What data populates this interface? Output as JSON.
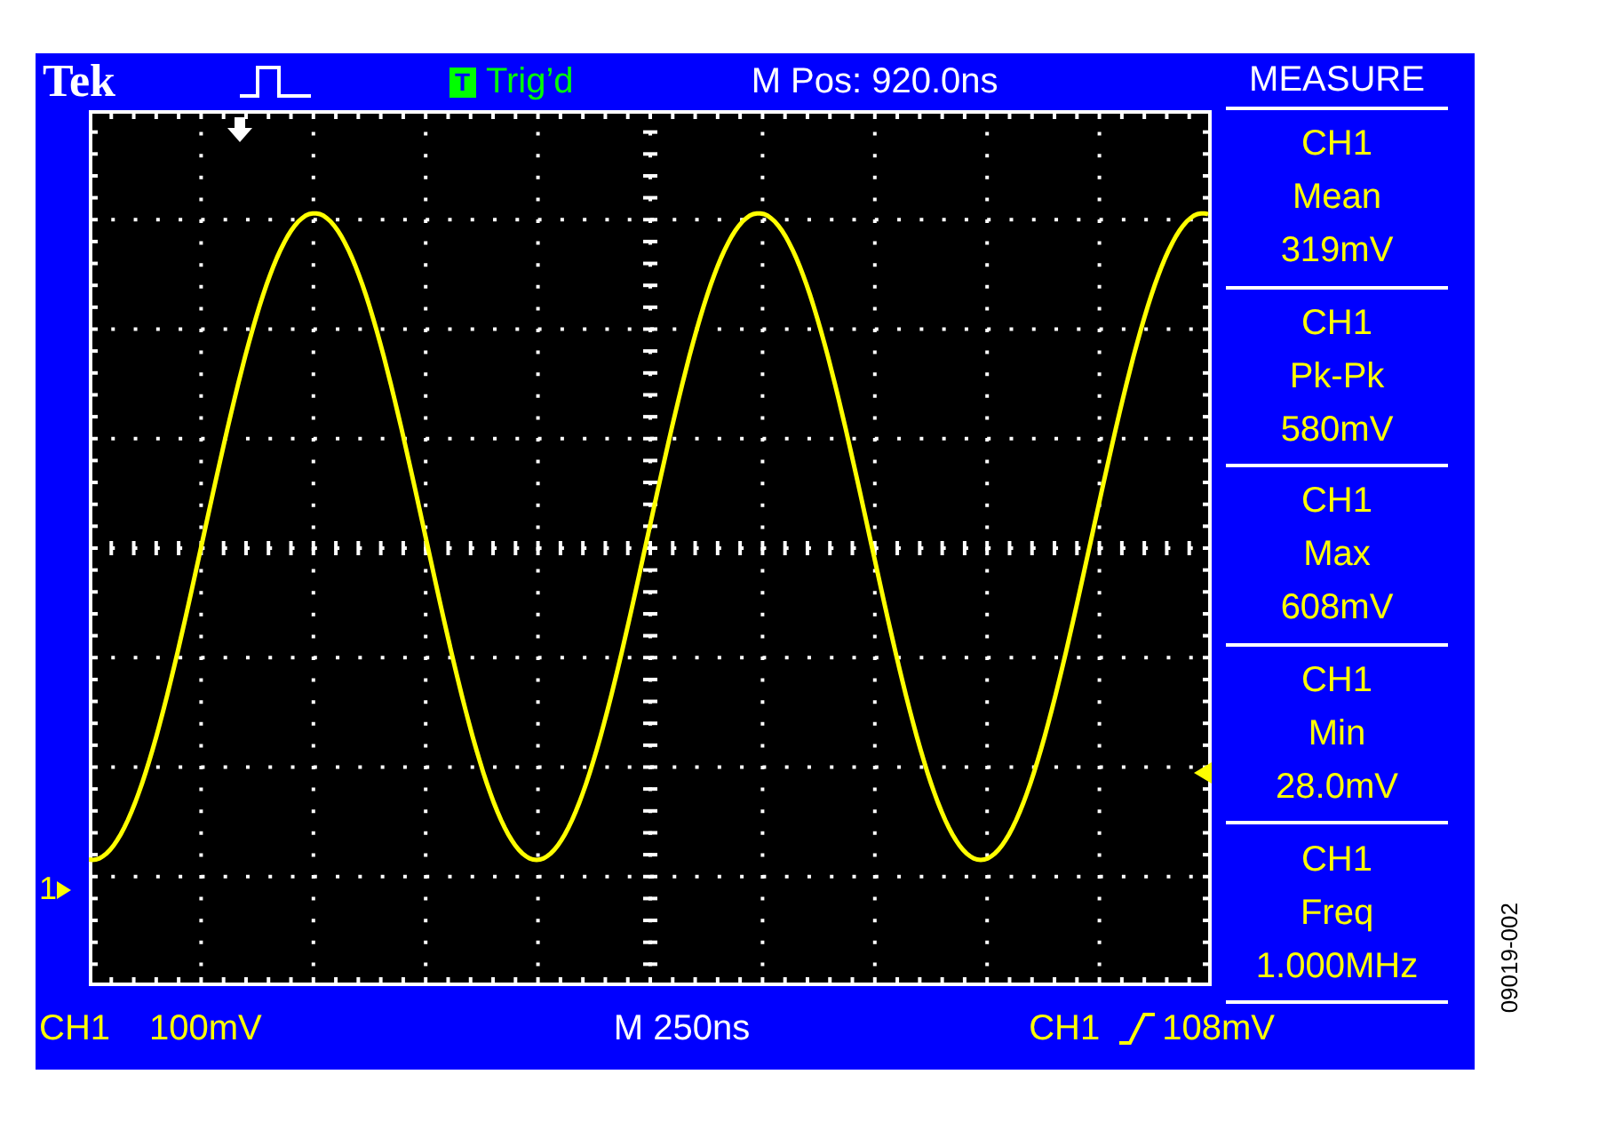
{
  "top_bar": {
    "brand": "Tek",
    "trigger_status": {
      "badge": "T",
      "label": "Trig’d"
    },
    "position": "M Pos: 920.0ns",
    "menu_title": "MEASURE"
  },
  "measurements": [
    {
      "channel": "CH1",
      "name": "Mean",
      "value": "319mV"
    },
    {
      "channel": "CH1",
      "name": "Pk-Pk",
      "value": "580mV"
    },
    {
      "channel": "CH1",
      "name": "Max",
      "value": "608mV"
    },
    {
      "channel": "CH1",
      "name": "Min",
      "value": "28.0mV"
    },
    {
      "channel": "CH1",
      "name": "Freq",
      "value": "1.000MHz"
    }
  ],
  "channel_marker": "1",
  "bottom_bar": {
    "channel": "CH1",
    "scale": "100mV",
    "timebase": "M 250ns",
    "trigger": {
      "source": "CH1",
      "level": "108mV"
    }
  },
  "figure_id": "09019-002"
}
